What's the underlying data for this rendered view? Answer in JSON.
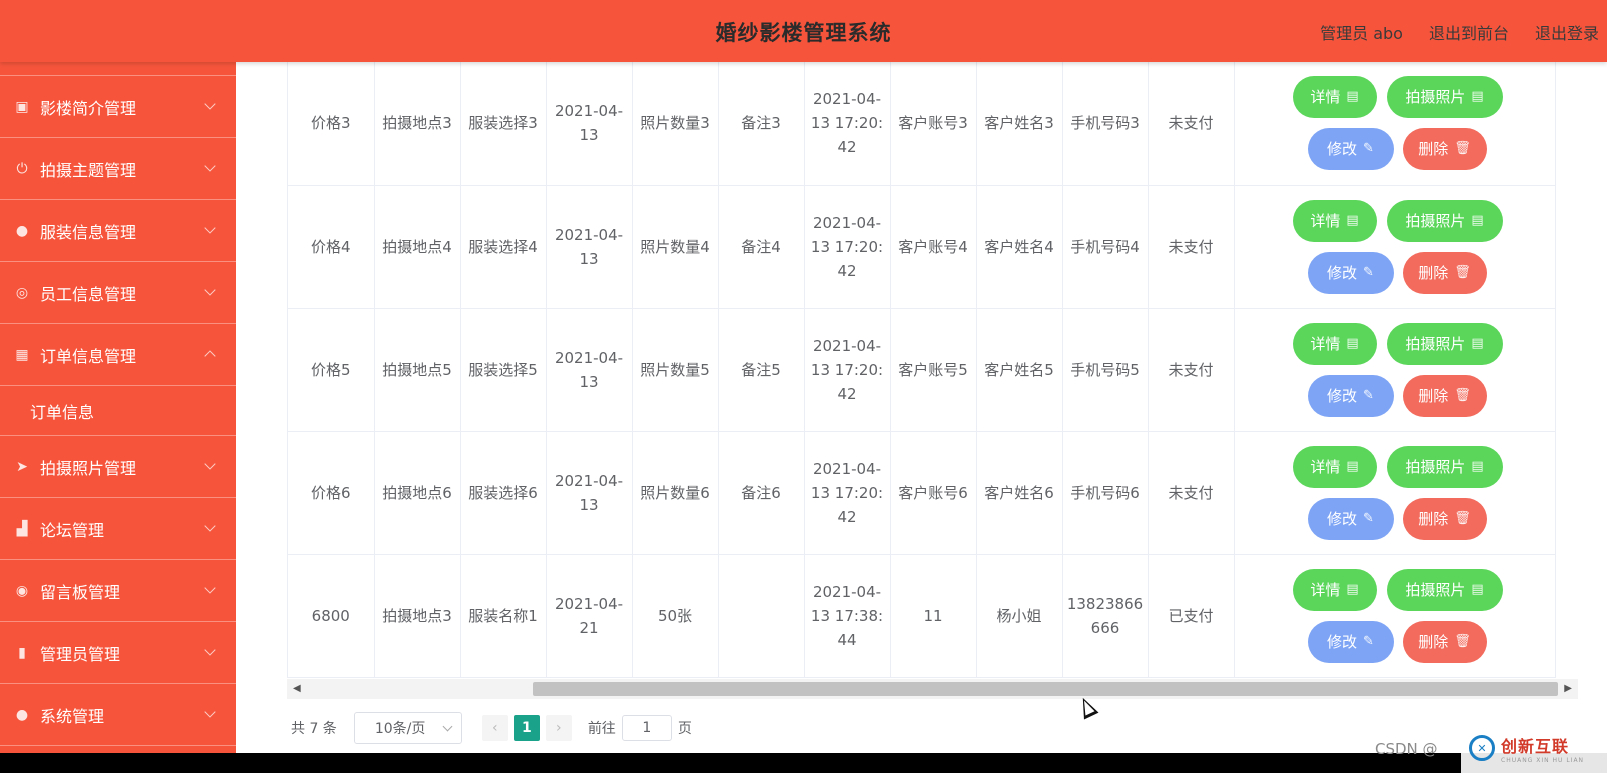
{
  "header": {
    "title": "婚纱影楼管理系统",
    "admin_label": "管理员 abo",
    "to_front_label": "退出到前台",
    "logout_label": "退出登录"
  },
  "sidebar": {
    "items": [
      {
        "label": "影楼简介管理",
        "icon": "image-icon"
      },
      {
        "label": "拍摄主题管理",
        "icon": "power-icon"
      },
      {
        "label": "服装信息管理",
        "icon": "user-icon"
      },
      {
        "label": "员工信息管理",
        "icon": "circle-icon"
      },
      {
        "label": "订单信息管理",
        "icon": "grid-icon"
      },
      {
        "label": "拍摄照片管理",
        "icon": "send-icon"
      },
      {
        "label": "论坛管理",
        "icon": "chart-icon"
      },
      {
        "label": "留言板管理",
        "icon": "location-icon"
      },
      {
        "label": "管理员管理",
        "icon": "bar-icon"
      },
      {
        "label": "系统管理",
        "icon": "user-icon"
      }
    ],
    "sub_item": "订单信息"
  },
  "rows": [
    {
      "price": "价格3",
      "location": "拍摄地点3",
      "clothing": "服装选择3",
      "date": "2021-04-13",
      "photos": "照片数量3",
      "remark": "备注3",
      "time": "2021-04-13 17:20:42",
      "account": "客户账号3",
      "name": "客户姓名3",
      "phone": "手机号码3",
      "status": "未支付"
    },
    {
      "price": "价格4",
      "location": "拍摄地点4",
      "clothing": "服装选择4",
      "date": "2021-04-13",
      "photos": "照片数量4",
      "remark": "备注4",
      "time": "2021-04-13 17:20:42",
      "account": "客户账号4",
      "name": "客户姓名4",
      "phone": "手机号码4",
      "status": "未支付"
    },
    {
      "price": "价格5",
      "location": "拍摄地点5",
      "clothing": "服装选择5",
      "date": "2021-04-13",
      "photos": "照片数量5",
      "remark": "备注5",
      "time": "2021-04-13 17:20:42",
      "account": "客户账号5",
      "name": "客户姓名5",
      "phone": "手机号码5",
      "status": "未支付"
    },
    {
      "price": "价格6",
      "location": "拍摄地点6",
      "clothing": "服装选择6",
      "date": "2021-04-13",
      "photos": "照片数量6",
      "remark": "备注6",
      "time": "2021-04-13 17:20:42",
      "account": "客户账号6",
      "name": "客户姓名6",
      "phone": "手机号码6",
      "status": "未支付"
    },
    {
      "price": "6800",
      "location": "拍摄地点3",
      "clothing": "服装名称1",
      "date": "2021-04-21",
      "photos": "50张",
      "remark": "",
      "time": "2021-04-13 17:38:44",
      "account": "11",
      "name": "杨小姐",
      "phone": "13823866666",
      "status": "已支付"
    }
  ],
  "actions": {
    "detail": "详情",
    "photo": "拍摄照片",
    "edit": "修改",
    "delete": "删除"
  },
  "pagination": {
    "total": "共 7 条",
    "page_size": "10条/页",
    "current_page": "1",
    "goto_label": "前往",
    "goto_value": "1",
    "page_unit": "页"
  },
  "watermark": "CSDN @",
  "logo": {
    "name": "创新互联",
    "sub": "CHUANG XIN HU LIAN"
  },
  "colors": {
    "brand": "#f6553c",
    "detail_btn": "#5bd65b",
    "edit_btn": "#7ea5f5",
    "delete_btn": "#f26b5d",
    "page_active": "#1aa28b"
  }
}
